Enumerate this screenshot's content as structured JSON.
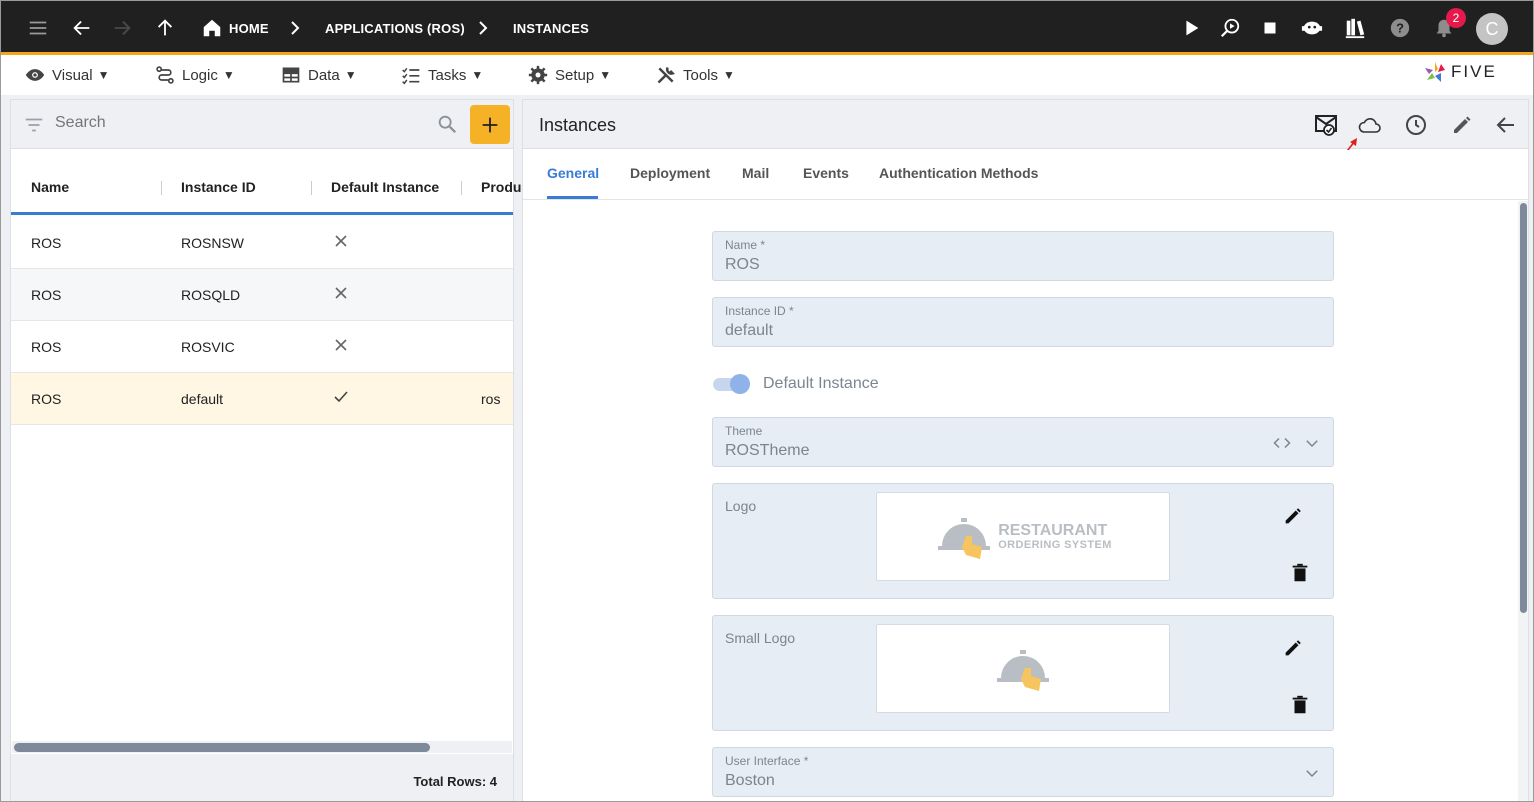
{
  "topbar": {
    "breadcrumbs": [
      "HOME",
      "APPLICATIONS (ROS)",
      "INSTANCES"
    ],
    "notification_count": "2",
    "avatar_initial": "C",
    "brand_color": "#f5a51b"
  },
  "menubar": {
    "items": [
      {
        "label": "Visual",
        "icon": "eye-icon"
      },
      {
        "label": "Logic",
        "icon": "flow-icon"
      },
      {
        "label": "Data",
        "icon": "table-icon"
      },
      {
        "label": "Tasks",
        "icon": "checklist-icon"
      },
      {
        "label": "Setup",
        "icon": "gear-icon"
      },
      {
        "label": "Tools",
        "icon": "tools-icon"
      }
    ],
    "caret": "▼",
    "logo_text": "FIVE"
  },
  "list": {
    "search_placeholder": "Search",
    "columns": [
      "Name",
      "Instance ID",
      "Default Instance",
      "Produ"
    ],
    "rows": [
      {
        "name": "ROS",
        "instance_id": "ROSNSW",
        "default": false,
        "product": ""
      },
      {
        "name": "ROS",
        "instance_id": "ROSQLD",
        "default": false,
        "product": ""
      },
      {
        "name": "ROS",
        "instance_id": "ROSVIC",
        "default": false,
        "product": ""
      },
      {
        "name": "ROS",
        "instance_id": "default",
        "default": true,
        "product": "ros"
      }
    ],
    "selected_row_index": 3,
    "total_rows": "Total Rows: 4"
  },
  "detail": {
    "title": "Instances",
    "tabs": [
      "General",
      "Deployment",
      "Mail",
      "Events",
      "Authentication Methods"
    ],
    "active_tab": "General",
    "fields": {
      "name_label": "Name *",
      "name_value": "ROS",
      "instance_id_label": "Instance ID *",
      "instance_id_value": "default",
      "default_instance_label": "Default Instance",
      "default_instance_on": true,
      "theme_label": "Theme",
      "theme_value": "ROSTheme",
      "logo_label": "Logo",
      "logo_text_line1": "RESTAURANT",
      "logo_text_line2": "ORDERING SYSTEM",
      "small_logo_label": "Small Logo",
      "user_interface_label": "User Interface *",
      "user_interface_value": "Boston"
    },
    "accent_color": "#3a7bd5"
  }
}
